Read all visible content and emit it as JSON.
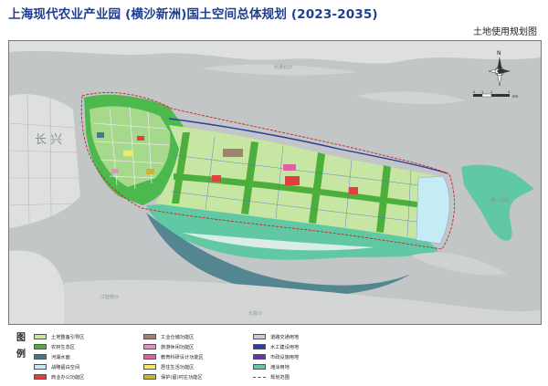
{
  "document": {
    "title": "上海现代农业产业园 (横沙新洲)国土空间总体规划 (2023-2035)",
    "map_name": "土地使用规划图"
  },
  "map": {
    "labels": {
      "changxing": "长 兴",
      "hengsha_east": "横沙浅滩",
      "north_channel": "北港北沙",
      "south_channel": "江亚南沙",
      "jiuduansha": "九段沙"
    },
    "compass": {
      "north": "N",
      "scale_unit": "km",
      "scale_values": [
        "0",
        "1",
        "2",
        "4"
      ]
    },
    "colors": {
      "water": "#c3c6c7",
      "land_outside": "#dedfdf",
      "farmland": "#c7e6a4",
      "forest": "#4daf3b",
      "urban": "#4db84d",
      "wetland": "#60c9a4",
      "lake": "#c5ecf5",
      "dark_water": "#3f7a86"
    }
  },
  "legend": {
    "header": "图 例",
    "items": [
      {
        "label": "土地整备引导区",
        "color": "#c7e6a4"
      },
      {
        "label": "工业仓储功能区",
        "color": "#a0826d"
      },
      {
        "label": "道路交通用地",
        "color": "#cfc7d8"
      },
      {
        "label": "农林生态区",
        "color": "#4daf3b"
      },
      {
        "label": "旅游休闲功能区",
        "color": "#e88fc0"
      },
      {
        "label": "水工建设用地",
        "color": "#2b3d9e"
      },
      {
        "label": "河湖水面",
        "color": "#3f7a86"
      },
      {
        "label": "教育科研设计功能区",
        "color": "#e060a0"
      },
      {
        "label": "市政设施用地",
        "color": "#6a2fb0"
      },
      {
        "label": "战略留白空间",
        "color": "#c5ecf5"
      },
      {
        "label": "居住生活功能区",
        "color": "#f2e96a"
      },
      {
        "label": "滩涂用地",
        "color": "#60c9a4"
      },
      {
        "label": "商业办公功能区",
        "color": "#e04040"
      },
      {
        "label": "保护(留)村庄功能区",
        "color": "#c9b43a"
      },
      {
        "label": "规划范围",
        "color": "#cc2222",
        "style": "line"
      }
    ]
  }
}
